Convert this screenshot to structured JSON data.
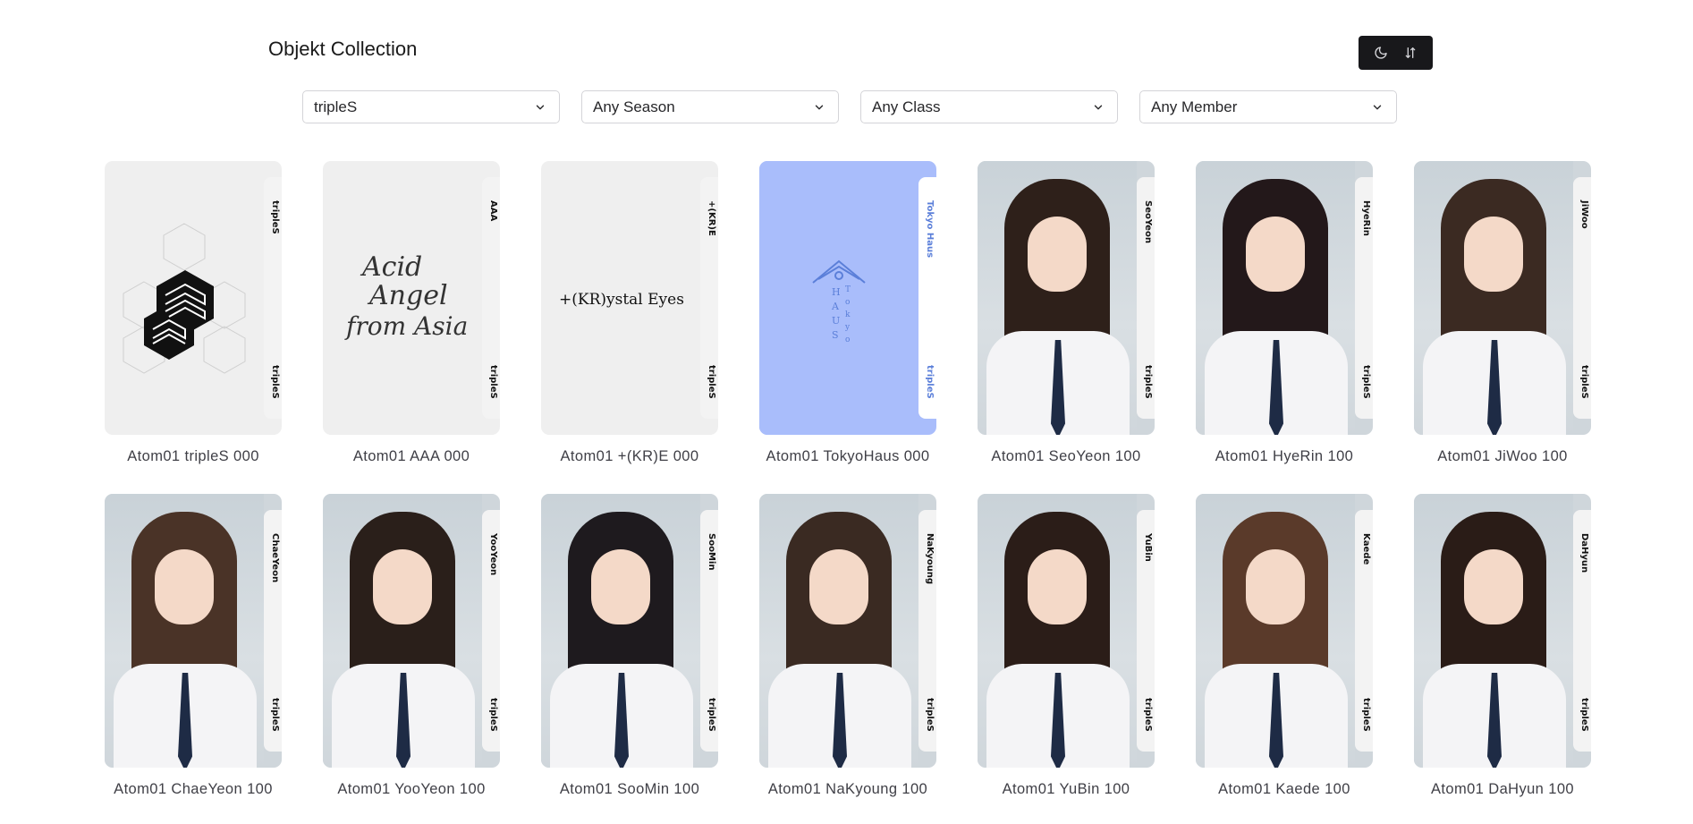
{
  "header": {
    "title": "Objekt Collection",
    "toolbar": [
      {
        "icon": "moon-icon"
      },
      {
        "icon": "sort-icon"
      }
    ]
  },
  "filters": [
    {
      "name": "artist-select",
      "value": "tripleS"
    },
    {
      "name": "season-select",
      "value": "Any Season"
    },
    {
      "name": "class-select",
      "value": "Any Class"
    },
    {
      "name": "member-select",
      "value": "Any Member"
    }
  ],
  "cards": [
    {
      "caption": "Atom01 tripleS 000",
      "strip_top": "tripleS",
      "strip_bot": "tripleS",
      "art": "triples-logo"
    },
    {
      "caption": "Atom01 AAA 000",
      "strip_top": "AAA",
      "strip_bot": "tripleS",
      "art": "Acid Angel from Asia"
    },
    {
      "caption": "Atom01 +(KR)E 000",
      "strip_top": "+(KR)E",
      "strip_bot": "tripleS",
      "art": "+(KR)ystal Eyes"
    },
    {
      "caption": "Atom01 TokyoHaus 000",
      "strip_top": "Tokyo Haus",
      "strip_bot": "tripleS",
      "art": "haus-logo"
    },
    {
      "caption": "Atom01 SeoYeon 100",
      "strip_top": "SeoYeon",
      "strip_bot": "tripleS",
      "art": "photo"
    },
    {
      "caption": "Atom01 HyeRin 100",
      "strip_top": "HyeRin",
      "strip_bot": "tripleS",
      "art": "photo"
    },
    {
      "caption": "Atom01 JiWoo 100",
      "strip_top": "JiWoo",
      "strip_bot": "tripleS",
      "art": "photo"
    },
    {
      "caption": "Atom01 ChaeYeon 100",
      "strip_top": "ChaeYeon",
      "strip_bot": "tripleS",
      "art": "photo"
    },
    {
      "caption": "Atom01 YooYeon 100",
      "strip_top": "YooYeon",
      "strip_bot": "tripleS",
      "art": "photo"
    },
    {
      "caption": "Atom01 SooMin 100",
      "strip_top": "SooMin",
      "strip_bot": "tripleS",
      "art": "photo"
    },
    {
      "caption": "Atom01 NaKyoung 100",
      "strip_top": "NaKyoung",
      "strip_bot": "tripleS",
      "art": "photo"
    },
    {
      "caption": "Atom01 YuBin 100",
      "strip_top": "YuBin",
      "strip_bot": "tripleS",
      "art": "photo"
    },
    {
      "caption": "Atom01 Kaede 100",
      "strip_top": "Kaede",
      "strip_bot": "tripleS",
      "art": "photo"
    },
    {
      "caption": "Atom01 DaHyun 100",
      "strip_top": "DaHyun",
      "strip_bot": "tripleS",
      "art": "photo"
    }
  ],
  "colors": {
    "toolbar_bg": "#18181b",
    "haus_card": "#a9bdfb",
    "haus_accent": "#5b7fd9"
  }
}
